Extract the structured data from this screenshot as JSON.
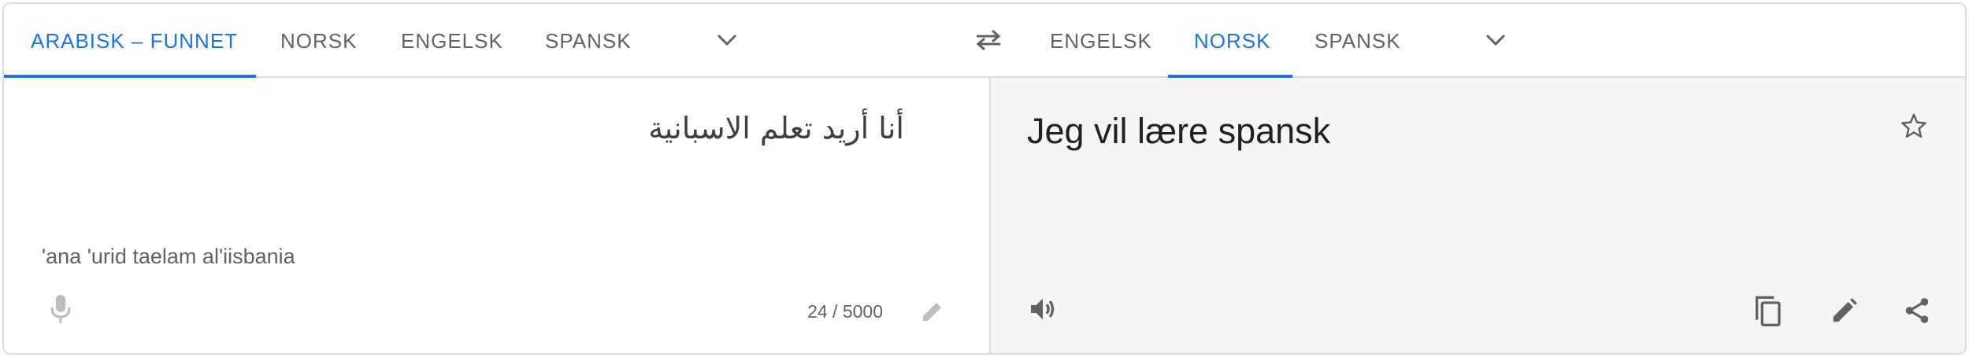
{
  "source_languages": {
    "tabs": [
      {
        "label": "ARABISK – FUNNET",
        "active": true
      },
      {
        "label": "NORSK",
        "active": false
      },
      {
        "label": "ENGELSK",
        "active": false
      },
      {
        "label": "SPANSK",
        "active": false
      }
    ],
    "more_icon": "chevron-down-icon"
  },
  "swap_icon": "swap-horiz-icon",
  "target_languages": {
    "tabs": [
      {
        "label": "ENGELSK",
        "active": false
      },
      {
        "label": "NORSK",
        "active": true
      },
      {
        "label": "SPANSK",
        "active": false
      }
    ],
    "more_icon": "chevron-down-icon"
  },
  "source": {
    "text": "أنا أريد تعلم الاسبانية",
    "transliteration": "'ana 'urid taelam al'iisbania",
    "char_count": "24 / 5000",
    "icons": [
      "mic-icon",
      "pencil-icon"
    ]
  },
  "target": {
    "text": "Jeg vil lære spansk",
    "icons": [
      "star-icon",
      "speaker-icon",
      "copy-icon",
      "pencil-icon",
      "share-icon"
    ]
  },
  "colors": {
    "accent": "#1a73e8",
    "tab_text": "#5f6368",
    "border": "#dadce0",
    "target_bg": "#f5f5f5",
    "disabled_icon": "#bdbdbd",
    "icon": "#5f6368"
  }
}
